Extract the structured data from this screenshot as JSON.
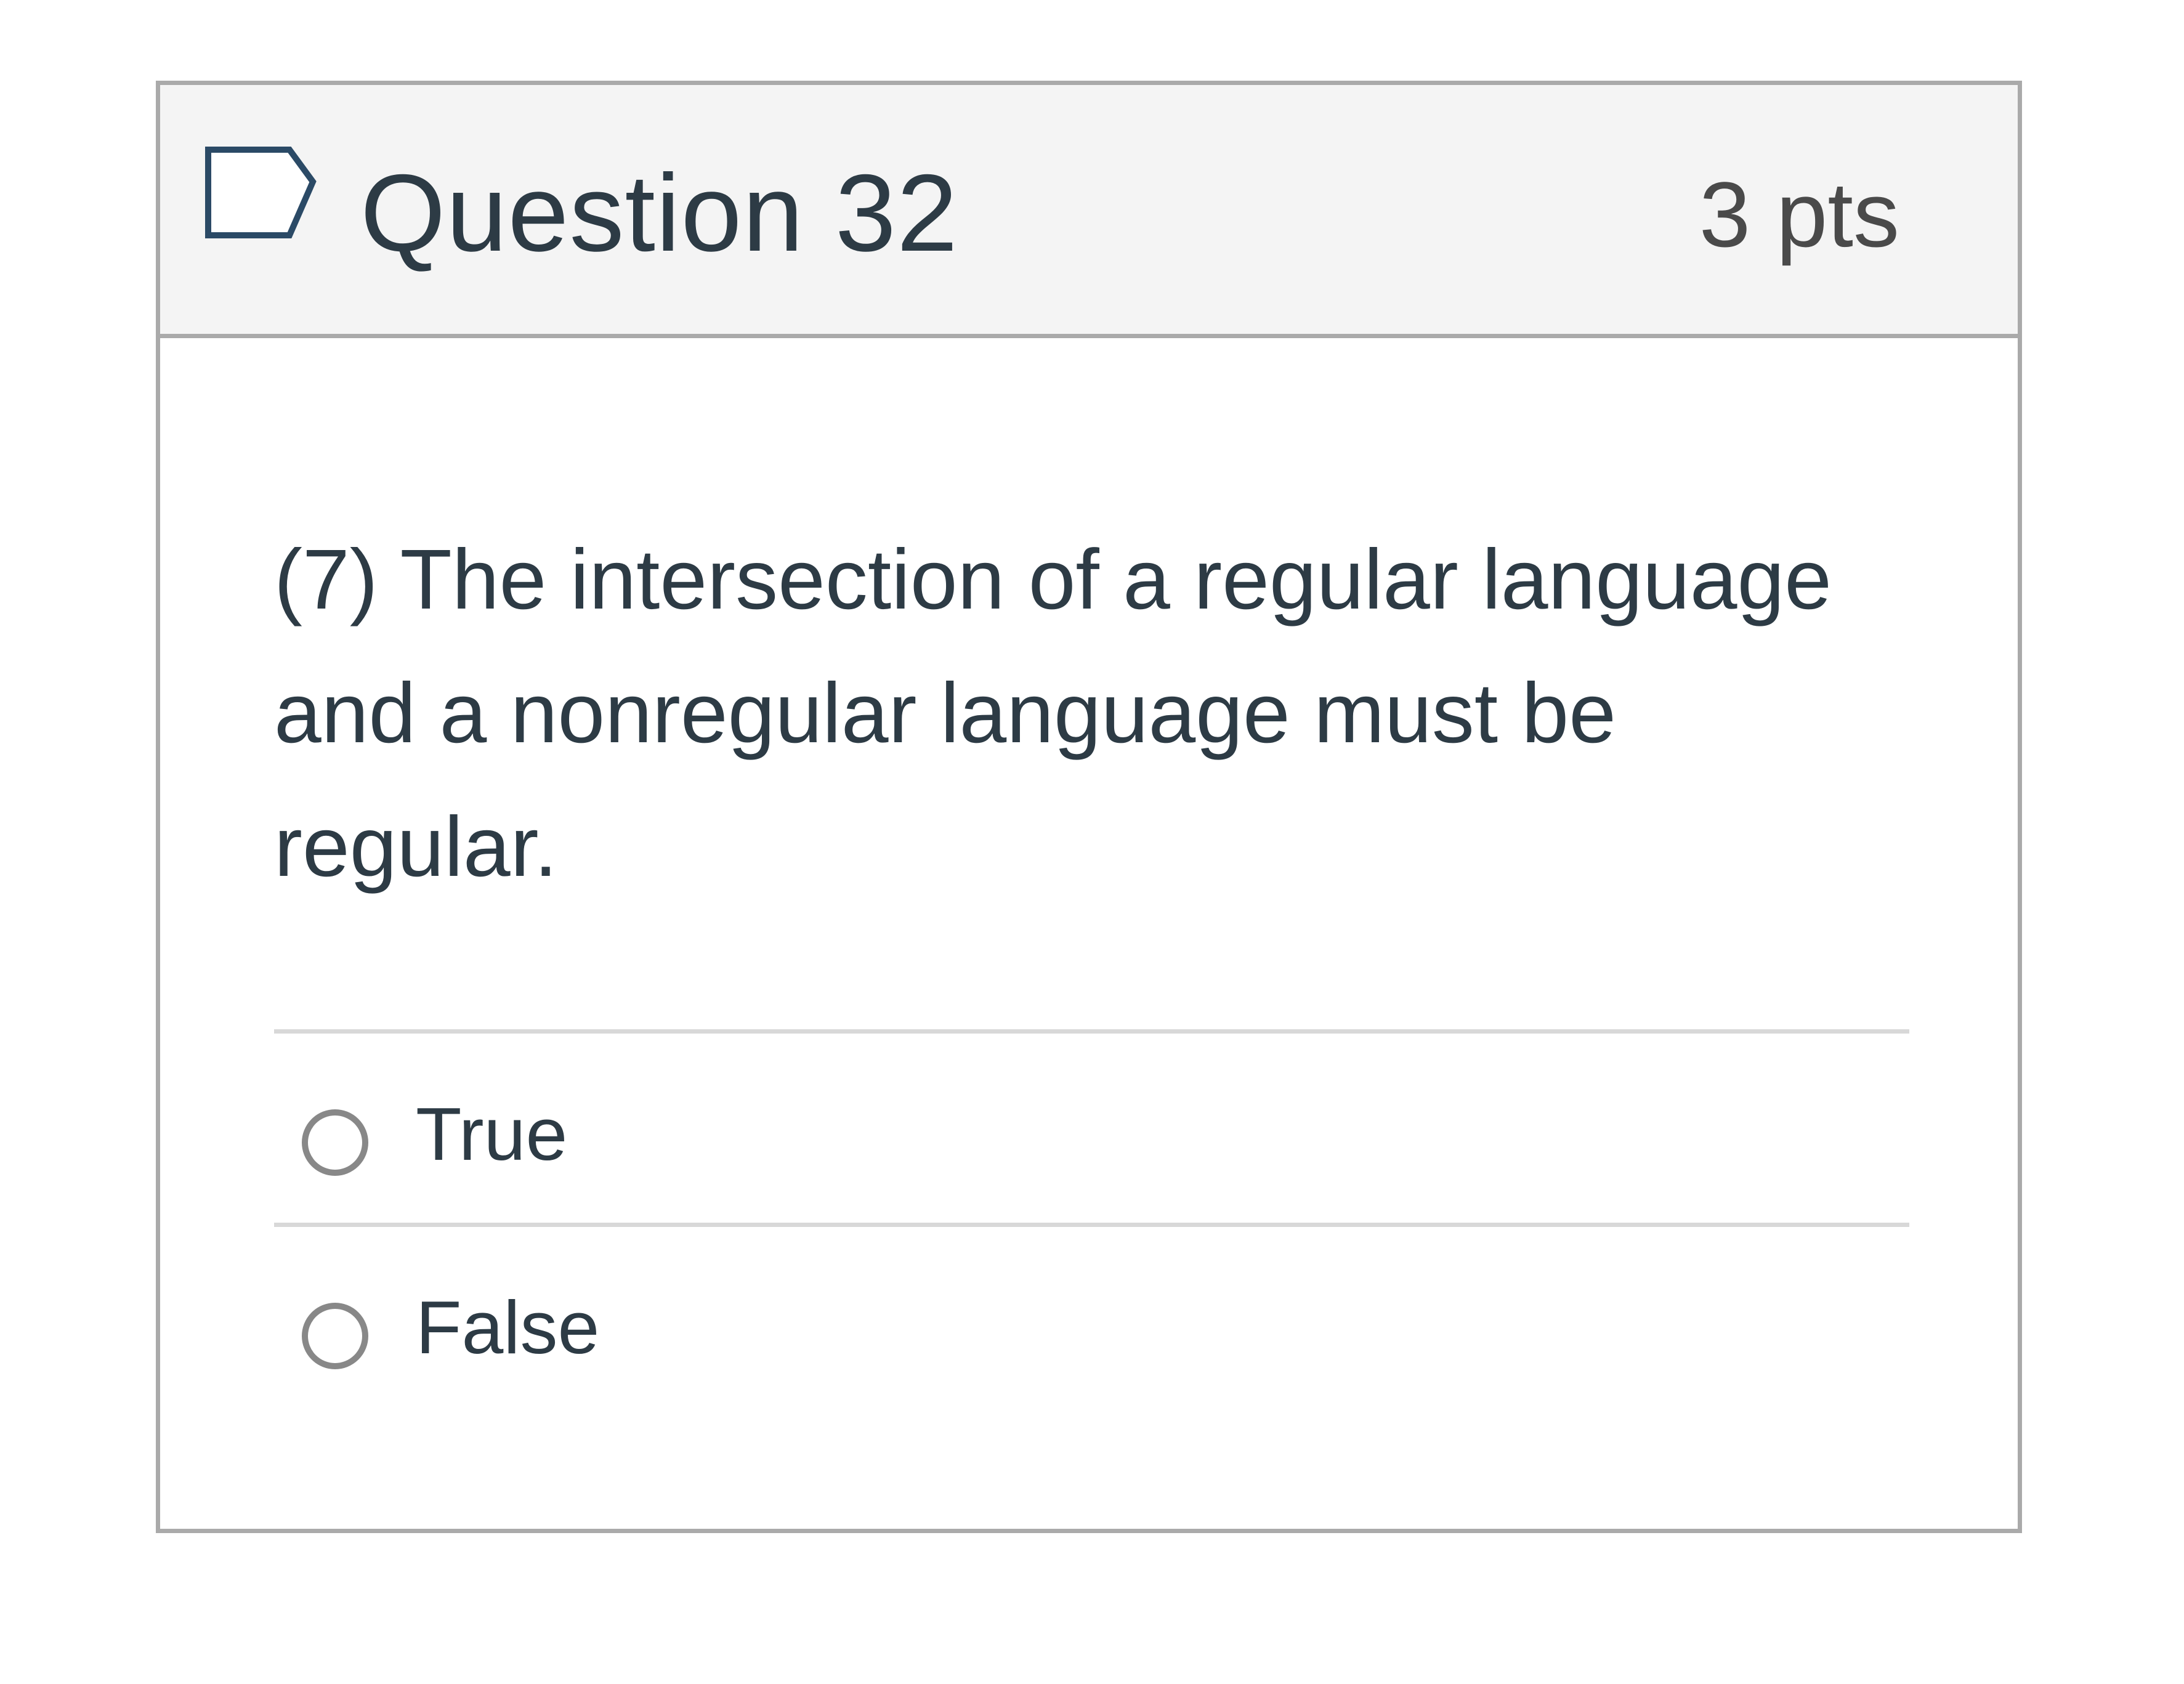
{
  "question": {
    "title": "Question 32",
    "points": "3 pts",
    "flag_icon": "flag-outline-icon",
    "text": "(7) The intersection of a regular language and a nonregular language must be regular.",
    "answers": [
      {
        "label": "True",
        "selected": false
      },
      {
        "label": "False",
        "selected": false
      }
    ]
  },
  "colors": {
    "header_background": "#f4f4f4",
    "border": "#aaaaaa",
    "text": "#2d3b45",
    "flag_outline": "#2b4a66",
    "radio_outline": "#888888"
  }
}
